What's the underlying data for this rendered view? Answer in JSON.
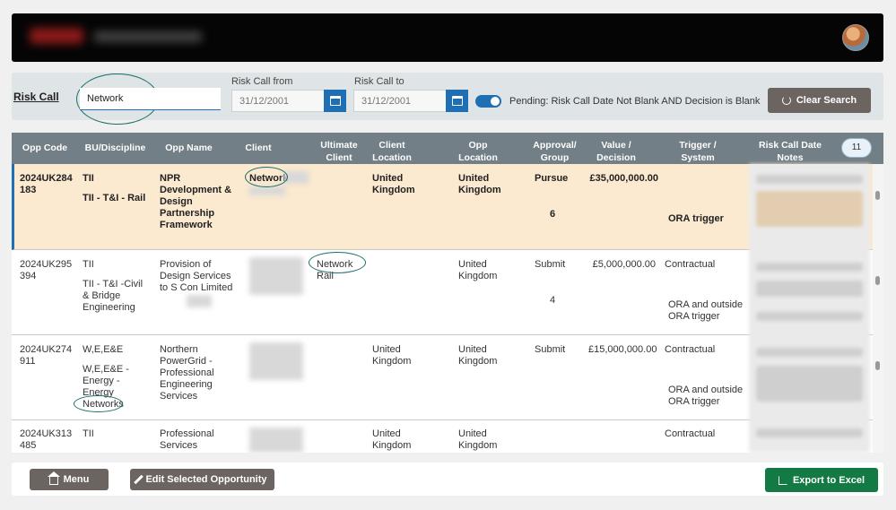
{
  "filters": {
    "risk_call_label": "Risk Call",
    "search_value": "Network",
    "from_label": "Risk Call from",
    "from_value": "31/12/2001",
    "to_label": "Risk Call to",
    "to_value": "31/12/2001",
    "pending_label": "Pending: Risk Call Date Not Blank AND Decision is Blank",
    "clear_label": "Clear Search"
  },
  "table": {
    "headers": [
      "Opp Code",
      "BU/Discipline",
      "Opp Name",
      "Client",
      "Ultimate Client",
      "Client Location",
      "Opp Location",
      "Approval/ Group",
      "Value / Decision",
      "Trigger / System",
      "Risk Call Date Notes"
    ],
    "count": "11",
    "rows": [
      {
        "code": "2024UK284 183",
        "bu1": "TII",
        "bu2": "TII - T&I - Rail",
        "name": "NPR Development & Design Partnership Framework",
        "client": "Network",
        "ultimate": "",
        "client_loc": "United Kingdom",
        "opp_loc": "United Kingdom",
        "approval": "Pursue",
        "group": "6",
        "value": "£35,000,000.00",
        "trigger1": "",
        "trigger2": "ORA trigger"
      },
      {
        "code": "2024UK295 394",
        "bu1": "TII",
        "bu2": "TII - T&I -Civil & Bridge Engineering",
        "name": "Provision of Design Services to S Con Limited",
        "client": "",
        "ultimate": "Network Rail",
        "client_loc": "",
        "opp_loc": "United Kingdom",
        "approval": "Submit",
        "group": "4",
        "value": "£5,000,000.00",
        "trigger1": "Contractual",
        "trigger2": "ORA and outside ORA trigger"
      },
      {
        "code": "2024UK274 911",
        "bu1": "W,E,E&E",
        "bu2": "W,E,E&E - Energy - Energy Networks",
        "name": "Northern PowerGrid - Professional Engineering Services",
        "client": "",
        "ultimate": "",
        "client_loc": "United Kingdom",
        "opp_loc": "United Kingdom",
        "approval": "Submit",
        "group": "",
        "value": "£15,000,000.00",
        "trigger1": "Contractual",
        "trigger2": "ORA and outside ORA trigger"
      },
      {
        "code": "2024UK313 485",
        "bu1": "TII",
        "bu2": "",
        "name": "Professional Services Contract",
        "client": "",
        "ultimate": "",
        "client_loc": "United Kingdom",
        "opp_loc": "United Kingdom",
        "approval": "",
        "group": "",
        "value": "",
        "trigger1": "Contractual",
        "trigger2": ""
      }
    ]
  },
  "footer": {
    "menu_label": "Menu",
    "edit_label": "Edit Selected Opportunity",
    "export_label": "Export to Excel"
  },
  "colors": {
    "accent": "#1f6fb5",
    "selected_row": "#fbe9d0",
    "header_bg": "#727f86",
    "export_green": "#137a43",
    "button_grey": "#6b6461"
  }
}
